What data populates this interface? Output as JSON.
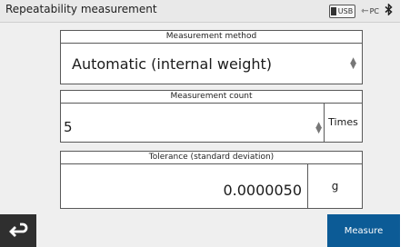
{
  "window": {
    "title": "Repeatability measurement",
    "status": {
      "usb_label": "USB",
      "pc_label": "PC",
      "bluetooth_icon": "bluetooth-icon"
    }
  },
  "measurement_method": {
    "header": "Measurement method",
    "value": "Automatic (internal weight)"
  },
  "measurement_count": {
    "header": "Measurement count",
    "value": "5",
    "unit": "Times"
  },
  "tolerance": {
    "header": "Tolerance (standard deviation)",
    "value": "0.0000050",
    "unit": "g"
  },
  "footer": {
    "back_icon": "return-arrow-icon",
    "measure_label": "Measure",
    "accent_color": "#0c5b96"
  }
}
